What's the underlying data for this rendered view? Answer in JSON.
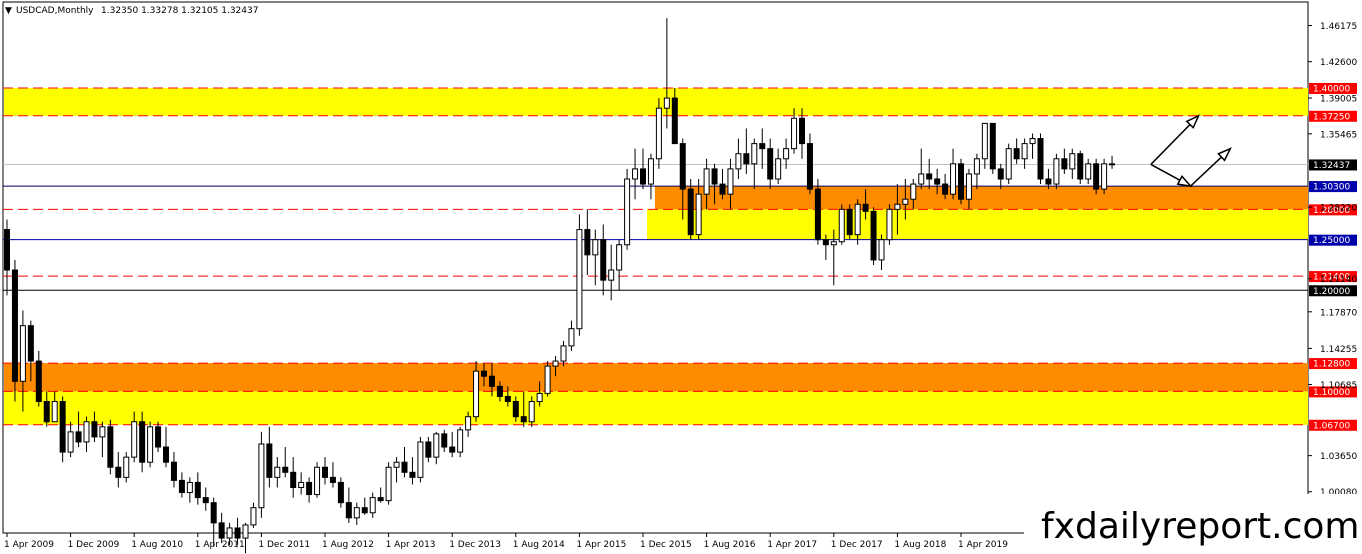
{
  "header": {
    "symbol": "USDCAD,Monthly",
    "ohlc": "1.32350 1.33278 1.32105 1.32437"
  },
  "watermark": "fxdailyreport.com",
  "colors": {
    "yellow": "#ffff00",
    "orange": "#ff8c00",
    "red_line": "#ff0000",
    "blue_line": "#0000aa",
    "bull": "#ffffff",
    "bear": "#000000"
  },
  "chart_data": {
    "type": "candlestick",
    "title": "USDCAD,Monthly",
    "ylim": [
      0.96,
      1.485
    ],
    "y_ticks": [
      "1.46175",
      "1.42600",
      "1.39005",
      "1.35465",
      "1.28220",
      "1.21140",
      "1.17870",
      "1.14255",
      "1.10685",
      "1.03650",
      "1.00080"
    ],
    "x_ticks": [
      "1 Apr 2009",
      "1 Dec 2009",
      "1 Aug 2010",
      "1 Apr 2011",
      "1 Dec 2011",
      "1 Aug 2012",
      "1 Apr 2013",
      "1 Dec 2013",
      "1 Aug 2014",
      "1 Apr 2015",
      "1 Dec 2015",
      "1 Aug 2016",
      "1 Apr 2017",
      "1 Dec 2017",
      "1 Aug 2018",
      "1 Apr 2019"
    ],
    "price_levels": [
      {
        "label": "1.40000",
        "value": 1.4,
        "style": "red-dash"
      },
      {
        "label": "1.37250",
        "value": 1.3725,
        "style": "red-dash"
      },
      {
        "label": "1.32437",
        "value": 1.32437,
        "style": "current"
      },
      {
        "label": "1.30300",
        "value": 1.303,
        "style": "solid-navy"
      },
      {
        "label": "1.28000",
        "value": 1.28,
        "style": "red-dash"
      },
      {
        "label": "1.25000",
        "value": 1.25,
        "style": "solid-blue"
      },
      {
        "label": "1.21400",
        "value": 1.214,
        "style": "red-dash"
      },
      {
        "label": "1.20000",
        "value": 1.2,
        "style": "solid-black"
      },
      {
        "label": "1.12800",
        "value": 1.128,
        "style": "red-dash"
      },
      {
        "label": "1.10000",
        "value": 1.1,
        "style": "red-dash"
      },
      {
        "label": "1.06700",
        "value": 1.067,
        "style": "red-dash"
      }
    ],
    "zones": [
      {
        "color": "yellow",
        "top": 1.4,
        "bottom": 1.3725,
        "from_bar": 0
      },
      {
        "color": "orange",
        "top": 1.303,
        "bottom": 1.28,
        "from_bar": 82
      },
      {
        "color": "yellow",
        "top": 1.28,
        "bottom": 1.25,
        "from_bar": 81
      },
      {
        "color": "orange",
        "top": 1.128,
        "bottom": 1.1,
        "from_bar": 0
      },
      {
        "color": "yellow",
        "top": 1.1,
        "bottom": 1.067,
        "from_bar": 0
      }
    ],
    "candles": [
      [
        1.26,
        1.27,
        1.195,
        1.22
      ],
      [
        1.22,
        1.23,
        1.09,
        1.11
      ],
      [
        1.11,
        1.18,
        1.08,
        1.165
      ],
      [
        1.165,
        1.17,
        1.11,
        1.13
      ],
      [
        1.13,
        1.14,
        1.085,
        1.09
      ],
      [
        1.09,
        1.1,
        1.065,
        1.07
      ],
      [
        1.07,
        1.1,
        1.07,
        1.09
      ],
      [
        1.09,
        1.095,
        1.03,
        1.04
      ],
      [
        1.04,
        1.07,
        1.035,
        1.06
      ],
      [
        1.06,
        1.08,
        1.045,
        1.05
      ],
      [
        1.05,
        1.075,
        1.04,
        1.07
      ],
      [
        1.07,
        1.08,
        1.05,
        1.055
      ],
      [
        1.055,
        1.07,
        1.035,
        1.065
      ],
      [
        1.065,
        1.072,
        1.018,
        1.025
      ],
      [
        1.025,
        1.04,
        1.005,
        1.015
      ],
      [
        1.015,
        1.04,
        1.01,
        1.035
      ],
      [
        1.035,
        1.08,
        1.03,
        1.07
      ],
      [
        1.07,
        1.08,
        1.02,
        1.03
      ],
      [
        1.03,
        1.07,
        1.025,
        1.065
      ],
      [
        1.065,
        1.07,
        1.04,
        1.045
      ],
      [
        1.045,
        1.065,
        1.025,
        1.03
      ],
      [
        1.03,
        1.04,
        1.005,
        1.012
      ],
      [
        1.012,
        1.02,
        0.995,
        1.0
      ],
      [
        1.0,
        1.015,
        0.99,
        1.01
      ],
      [
        1.01,
        1.02,
        0.988,
        0.995
      ],
      [
        0.995,
        1.005,
        0.982,
        0.99
      ],
      [
        0.99,
        0.995,
        0.947,
        0.97
      ],
      [
        0.97,
        0.98,
        0.95,
        0.955
      ],
      [
        0.955,
        0.97,
        0.948,
        0.965
      ],
      [
        0.965,
        0.975,
        0.948,
        0.955
      ],
      [
        0.955,
        0.97,
        0.94,
        0.968
      ],
      [
        0.968,
        0.99,
        0.965,
        0.985
      ],
      [
        0.985,
        1.06,
        0.975,
        1.048
      ],
      [
        1.048,
        1.065,
        1.005,
        1.015
      ],
      [
        1.015,
        1.035,
        1.005,
        1.025
      ],
      [
        1.025,
        1.045,
        1.015,
        1.02
      ],
      [
        1.02,
        1.035,
        0.995,
        1.005
      ],
      [
        1.005,
        1.02,
        0.998,
        1.01
      ],
      [
        1.01,
        1.015,
        0.99,
        0.998
      ],
      [
        0.998,
        1.03,
        0.995,
        1.025
      ],
      [
        1.025,
        1.035,
        1.008,
        1.015
      ],
      [
        1.015,
        1.03,
        1.005,
        1.01
      ],
      [
        1.01,
        1.015,
        0.985,
        0.99
      ],
      [
        0.99,
        1.005,
        0.97,
        0.975
      ],
      [
        0.975,
        0.99,
        0.968,
        0.985
      ],
      [
        0.985,
        0.995,
        0.978,
        0.98
      ],
      [
        0.98,
        1.0,
        0.975,
        0.995
      ],
      [
        0.995,
        1.005,
        0.99,
        0.992
      ],
      [
        0.992,
        1.03,
        0.988,
        1.025
      ],
      [
        1.025,
        1.035,
        1.01,
        1.03
      ],
      [
        1.03,
        1.045,
        1.015,
        1.02
      ],
      [
        1.02,
        1.035,
        1.008,
        1.015
      ],
      [
        1.015,
        1.055,
        1.01,
        1.05
      ],
      [
        1.05,
        1.055,
        1.03,
        1.035
      ],
      [
        1.035,
        1.06,
        1.028,
        1.058
      ],
      [
        1.058,
        1.062,
        1.04,
        1.045
      ],
      [
        1.045,
        1.06,
        1.035,
        1.04
      ],
      [
        1.04,
        1.065,
        1.035,
        1.062
      ],
      [
        1.062,
        1.08,
        1.055,
        1.075
      ],
      [
        1.075,
        1.13,
        1.07,
        1.12
      ],
      [
        1.12,
        1.128,
        1.105,
        1.115
      ],
      [
        1.115,
        1.128,
        1.095,
        1.105
      ],
      [
        1.105,
        1.11,
        1.09,
        1.095
      ],
      [
        1.095,
        1.105,
        1.085,
        1.09
      ],
      [
        1.09,
        1.095,
        1.07,
        1.075
      ],
      [
        1.075,
        1.1,
        1.065,
        1.07
      ],
      [
        1.07,
        1.095,
        1.065,
        1.09
      ],
      [
        1.09,
        1.11,
        1.085,
        1.098
      ],
      [
        1.098,
        1.13,
        1.095,
        1.125
      ],
      [
        1.125,
        1.135,
        1.115,
        1.13
      ],
      [
        1.13,
        1.15,
        1.125,
        1.145
      ],
      [
        1.145,
        1.17,
        1.14,
        1.162
      ],
      [
        1.162,
        1.275,
        1.155,
        1.26
      ],
      [
        1.26,
        1.28,
        1.215,
        1.235
      ],
      [
        1.235,
        1.26,
        1.205,
        1.25
      ],
      [
        1.25,
        1.265,
        1.195,
        1.21
      ],
      [
        1.21,
        1.245,
        1.19,
        1.22
      ],
      [
        1.22,
        1.25,
        1.2,
        1.245
      ],
      [
        1.245,
        1.32,
        1.24,
        1.31
      ],
      [
        1.31,
        1.34,
        1.29,
        1.32
      ],
      [
        1.32,
        1.34,
        1.3,
        1.305
      ],
      [
        1.305,
        1.335,
        1.29,
        1.33
      ],
      [
        1.33,
        1.39,
        1.32,
        1.38
      ],
      [
        1.38,
        1.469,
        1.36,
        1.39
      ],
      [
        1.39,
        1.4,
        1.345,
        1.345
      ],
      [
        1.345,
        1.35,
        1.27,
        1.3
      ],
      [
        1.3,
        1.31,
        1.25,
        1.255
      ],
      [
        1.255,
        1.31,
        1.25,
        1.295
      ],
      [
        1.295,
        1.33,
        1.28,
        1.32
      ],
      [
        1.32,
        1.325,
        1.285,
        1.305
      ],
      [
        1.305,
        1.32,
        1.29,
        1.295
      ],
      [
        1.295,
        1.33,
        1.28,
        1.32
      ],
      [
        1.32,
        1.35,
        1.31,
        1.335
      ],
      [
        1.335,
        1.36,
        1.315,
        1.325
      ],
      [
        1.325,
        1.35,
        1.3,
        1.345
      ],
      [
        1.345,
        1.36,
        1.32,
        1.34
      ],
      [
        1.34,
        1.35,
        1.3,
        1.31
      ],
      [
        1.31,
        1.34,
        1.305,
        1.33
      ],
      [
        1.33,
        1.35,
        1.32,
        1.34
      ],
      [
        1.34,
        1.38,
        1.335,
        1.37
      ],
      [
        1.37,
        1.38,
        1.33,
        1.345
      ],
      [
        1.345,
        1.355,
        1.295,
        1.3
      ],
      [
        1.3,
        1.31,
        1.245,
        1.25
      ],
      [
        1.25,
        1.255,
        1.23,
        1.245
      ],
      [
        1.245,
        1.26,
        1.205,
        1.248
      ],
      [
        1.248,
        1.285,
        1.245,
        1.28
      ],
      [
        1.28,
        1.285,
        1.25,
        1.255
      ],
      [
        1.255,
        1.29,
        1.245,
        1.285
      ],
      [
        1.285,
        1.3,
        1.27,
        1.278
      ],
      [
        1.278,
        1.282,
        1.225,
        1.23
      ],
      [
        1.23,
        1.255,
        1.22,
        1.25
      ],
      [
        1.25,
        1.285,
        1.245,
        1.28
      ],
      [
        1.28,
        1.305,
        1.255,
        1.285
      ],
      [
        1.285,
        1.31,
        1.27,
        1.29
      ],
      [
        1.29,
        1.31,
        1.28,
        1.305
      ],
      [
        1.305,
        1.34,
        1.3,
        1.315
      ],
      [
        1.315,
        1.33,
        1.3,
        1.31
      ],
      [
        1.31,
        1.32,
        1.295,
        1.305
      ],
      [
        1.305,
        1.315,
        1.29,
        1.295
      ],
      [
        1.295,
        1.34,
        1.29,
        1.325
      ],
      [
        1.325,
        1.33,
        1.285,
        1.29
      ],
      [
        1.29,
        1.32,
        1.28,
        1.315
      ],
      [
        1.315,
        1.335,
        1.3,
        1.33
      ],
      [
        1.33,
        1.365,
        1.32,
        1.365
      ],
      [
        1.365,
        1.365,
        1.315,
        1.32
      ],
      [
        1.32,
        1.325,
        1.3,
        1.31
      ],
      [
        1.31,
        1.345,
        1.305,
        1.34
      ],
      [
        1.34,
        1.35,
        1.325,
        1.33
      ],
      [
        1.33,
        1.35,
        1.32,
        1.345
      ],
      [
        1.345,
        1.355,
        1.33,
        1.35
      ],
      [
        1.35,
        1.355,
        1.305,
        1.31
      ],
      [
        1.31,
        1.32,
        1.3,
        1.305
      ],
      [
        1.305,
        1.335,
        1.3,
        1.33
      ],
      [
        1.33,
        1.34,
        1.315,
        1.32
      ],
      [
        1.32,
        1.34,
        1.31,
        1.335
      ],
      [
        1.335,
        1.338,
        1.305,
        1.31
      ],
      [
        1.31,
        1.33,
        1.305,
        1.325
      ],
      [
        1.325,
        1.33,
        1.295,
        1.3
      ],
      [
        1.3,
        1.33,
        1.295,
        1.325
      ],
      [
        1.325,
        1.333,
        1.32,
        1.3244
      ]
    ],
    "arrows": [
      {
        "from": [
          1.3244,
          143
        ],
        "to": [
          1.3725,
          149
        ]
      },
      {
        "from": [
          1.3244,
          143
        ],
        "to": [
          1.303,
          148
        ]
      },
      {
        "from": [
          1.303,
          148
        ],
        "to": [
          1.34,
          153
        ]
      }
    ]
  }
}
